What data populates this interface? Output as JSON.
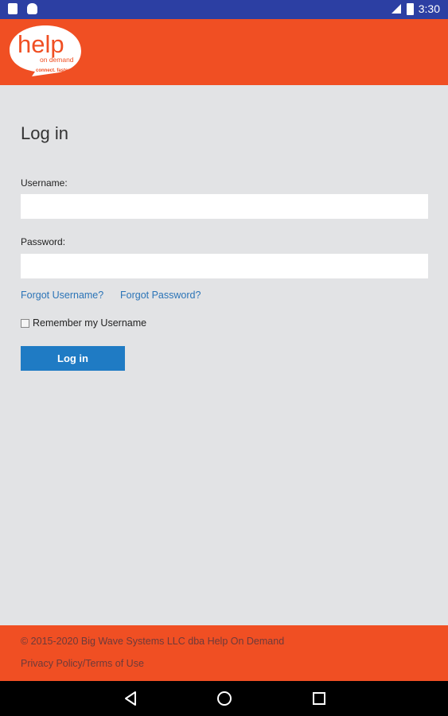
{
  "status_bar": {
    "time": "3:30",
    "left_icons": [
      "sd-card-icon",
      "android-icon"
    ],
    "right_icons": [
      "signal-icon",
      "battery-icon"
    ]
  },
  "header": {
    "logo_text_main": "help",
    "logo_text_sub": "on demand",
    "logo_tagline": "connect. faster",
    "brand_color": "#f04f23"
  },
  "login": {
    "title": "Log in",
    "username_label": "Username:",
    "username_value": "",
    "password_label": "Password:",
    "password_value": "",
    "forgot_username": "Forgot Username?",
    "forgot_password": "Forgot Password?",
    "remember_label": "Remember my Username",
    "remember_checked": false,
    "login_button": "Log in",
    "button_color": "#1f7bc4",
    "link_color": "#2b74b7"
  },
  "footer": {
    "copyright": "© 2015-2020 Big Wave Systems LLC dba Help On Demand",
    "privacy_link": "Privacy Policy/Terms of Use"
  },
  "nav_bar": {
    "buttons": [
      "back-icon",
      "home-icon",
      "recents-icon"
    ]
  }
}
